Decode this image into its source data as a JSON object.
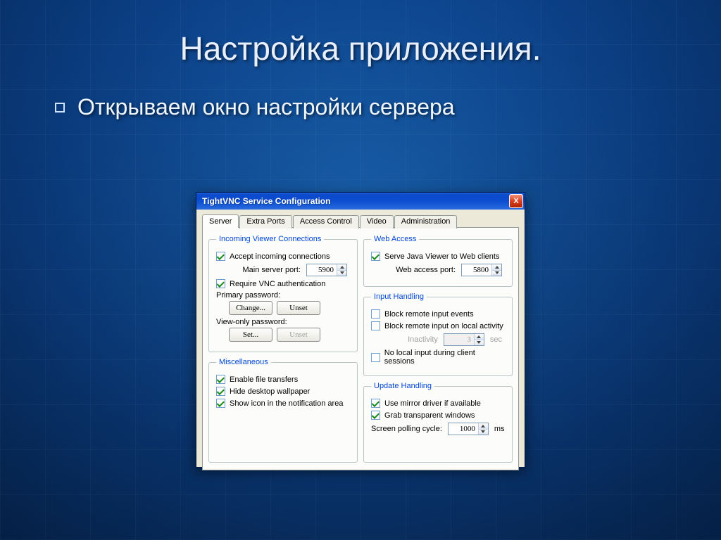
{
  "slide": {
    "title": "Настройка приложения.",
    "bullet": "Открываем окно настройки сервера"
  },
  "dialog": {
    "title": "TightVNC Service Configuration",
    "close": "X",
    "tabs": [
      "Server",
      "Extra Ports",
      "Access Control",
      "Video",
      "Administration"
    ],
    "activeTab": 0,
    "incoming": {
      "legend": "Incoming Viewer Connections",
      "accept": "Accept incoming connections",
      "mainPortLabel": "Main server port:",
      "mainPort": "5900",
      "requireAuth": "Require VNC authentication",
      "primaryPwd": "Primary password:",
      "changeBtn": "Change...",
      "unsetPrimary": "Unset",
      "viewOnlyPwd": "View-only password:",
      "setBtn": "Set...",
      "unsetView": "Unset"
    },
    "misc": {
      "legend": "Miscellaneous",
      "file": "Enable file transfers",
      "wallpaper": "Hide desktop wallpaper",
      "tray": "Show icon in the notification area"
    },
    "web": {
      "legend": "Web Access",
      "serve": "Serve Java Viewer to Web clients",
      "portLabel": "Web access port:",
      "port": "5800"
    },
    "input": {
      "legend": "Input Handling",
      "blockRemote": "Block remote input events",
      "blockLocal": "Block remote input on local activity",
      "inactivityLabel": "Inactivity",
      "inactivity": "3",
      "inactivityUnit": "sec",
      "noLocal": "No local input during client sessions"
    },
    "update": {
      "legend": "Update Handling",
      "mirror": "Use mirror driver if available",
      "grab": "Grab transparent windows",
      "pollLabel": "Screen polling cycle:",
      "poll": "1000",
      "pollUnit": "ms"
    }
  }
}
